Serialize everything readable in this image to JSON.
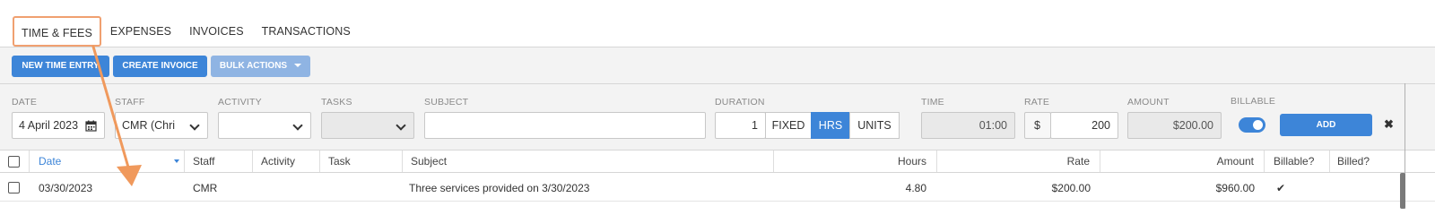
{
  "tabs": [
    {
      "label": "TIME & FEES"
    },
    {
      "label": "EXPENSES"
    },
    {
      "label": "INVOICES"
    },
    {
      "label": "TRANSACTIONS"
    }
  ],
  "toolbar": {
    "new_time_entry": "NEW TIME ENTRY",
    "create_invoice": "CREATE INVOICE",
    "bulk_actions": "BULK ACTIONS"
  },
  "form": {
    "labels": {
      "date": "DATE",
      "staff": "STAFF",
      "activity": "ACTIVITY",
      "tasks": "TASKS",
      "subject": "SUBJECT",
      "duration": "DURATION",
      "time": "TIME",
      "rate": "RATE",
      "amount": "AMOUNT",
      "billable": "BILLABLE"
    },
    "date_value": "4 April 2023",
    "staff_value": "CMR (Chri",
    "activity_value": "",
    "tasks_value": "",
    "subject_value": "",
    "duration_value": "1",
    "duration_modes": [
      "FIXED",
      "HRS",
      "UNITS"
    ],
    "duration_selected": "HRS",
    "time_value": "01:00",
    "rate_currency": "$",
    "rate_value": "200",
    "amount_value": "$200.00",
    "billable": true,
    "add_label": "ADD",
    "close_glyph": "✖"
  },
  "table": {
    "columns": [
      "Date",
      "Staff",
      "Activity",
      "Task",
      "Subject",
      "Hours",
      "Rate",
      "Amount",
      "Billable?",
      "Billed?"
    ],
    "rows": [
      {
        "date": "03/30/2023",
        "staff": "CMR",
        "activity": "",
        "task": "",
        "subject": "Three services provided on 3/30/2023",
        "hours": "4.80",
        "rate": "$200.00",
        "amount": "$960.00",
        "billable": "✔",
        "billed": ""
      }
    ]
  },
  "colors": {
    "accent": "#3d85d8",
    "accent_light": "#8fb4e3",
    "highlight": "#f0a070",
    "arrow": "#f0995c"
  },
  "icons": {
    "calendar": "calendar-icon",
    "sort": "sort-desc-icon",
    "close": "close-icon",
    "check": "check-icon"
  }
}
